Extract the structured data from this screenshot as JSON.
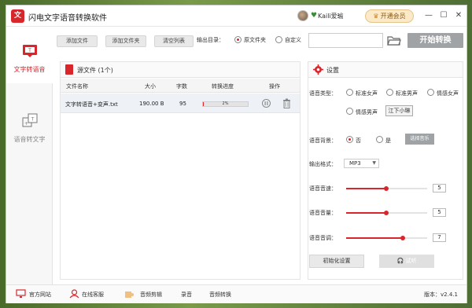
{
  "app": {
    "title": "闪电文字语音转换软件",
    "logo_char": "文"
  },
  "header": {
    "user_name": "Kaili爱瑜",
    "vip_label": "开通会员",
    "controls": [
      "—",
      "☐",
      "✕"
    ]
  },
  "sidebar": {
    "items": [
      {
        "label": "文字转语音",
        "icon": "text-to-speech-icon",
        "active": true
      },
      {
        "label": "语音转文字",
        "icon": "speech-to-text-icon",
        "active": false
      }
    ]
  },
  "toolbar": {
    "add_file": "添加文件",
    "add_folder": "添加文件夹",
    "clear_list": "清空列表",
    "output_dir_label": "输出目录：",
    "radio_source": "原文件夹",
    "radio_custom": "自定义",
    "path_value": "",
    "start": "开始转换"
  },
  "file_panel": {
    "title": "源文件 (1个)",
    "columns": [
      "文件名称",
      "大小",
      "字数",
      "转换进度",
      "操作"
    ],
    "rows": [
      {
        "name": "文字转语音+变声.txt",
        "size": "190.00 B",
        "chars": "95",
        "progress_label": "2%",
        "progress": 0.02
      }
    ]
  },
  "settings": {
    "title": "设置",
    "voice_type_label": "语音类型：",
    "voice_options": [
      "标准女声",
      "标准男声",
      "情感女声",
      "情感男声"
    ],
    "voice_selected": "江下小琳",
    "bg_label": "语音背景：",
    "bg_no": "否",
    "bg_yes": "是",
    "choose_music": "选择音乐",
    "format_label": "输出格式：",
    "format_value": "MP3",
    "speed_label": "语音音速：",
    "speed_value": "5",
    "volume_label": "语音音量：",
    "volume_value": "5",
    "pitch_label": "语音音调：",
    "pitch_value": "7",
    "init_btn": "初始化设置",
    "try_btn": "试听"
  },
  "bottom": {
    "website": "官方网站",
    "service": "在线客服",
    "audio_edit": "音频剪辑",
    "record": "录音",
    "audio_convert": "音频转换",
    "version": "版本：v2.4.1"
  },
  "colors": {
    "accent": "#d9262b",
    "start_btn": "#9fa3a6"
  }
}
